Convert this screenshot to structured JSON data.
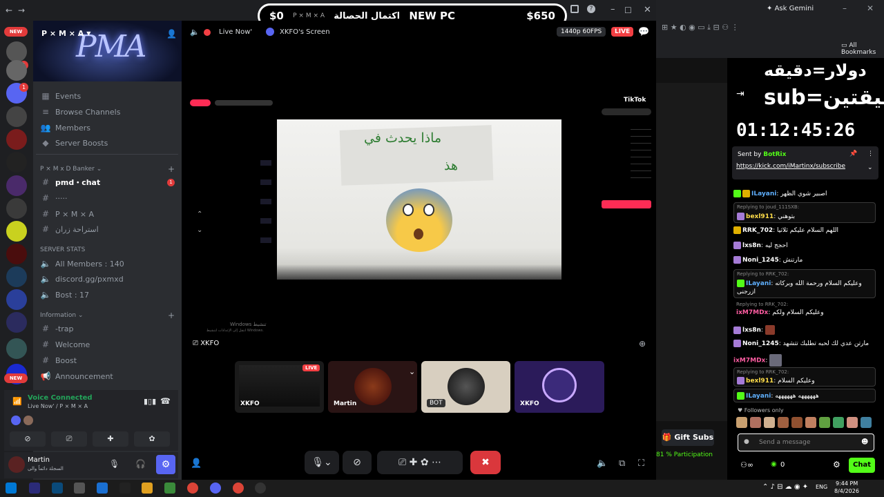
{
  "overlay": {
    "left_amount": "$0",
    "server_tag": "P × M × A",
    "goal_text": "اكتمال الحصالة",
    "goal_item": "NEW PC",
    "right_amount": "$650"
  },
  "server": {
    "name": "P × M × A"
  },
  "rail": {
    "badges": [
      "NEW",
      "1",
      "1",
      "1",
      "NEW"
    ]
  },
  "sidebar": {
    "menu": [
      "Events",
      "Browse Channels",
      "Members",
      "Server Boosts"
    ],
    "category1": "P × M x D Banker",
    "channels1": [
      {
        "icon": "#",
        "label": "pmd・chat",
        "badge": "1"
      },
      {
        "icon": "#",
        "label": "·····"
      },
      {
        "icon": "#",
        "label": "P × M × A"
      },
      {
        "icon": "#",
        "label": "استراحة زران"
      }
    ],
    "category2": "SERVER STATS",
    "stats": [
      "All Members : 140",
      "discord.gg/pxmxd",
      "Bost : 17"
    ],
    "category3": "Information",
    "channels3": [
      "-trap",
      "Welcome",
      "Boost",
      "Announcement"
    ]
  },
  "voice": {
    "status": "Voice Connected",
    "channel": "Live Now' / P × M × A"
  },
  "user": {
    "name": "Martin",
    "status": "السجلة دائماً والى"
  },
  "stream": {
    "live_label": "Live Now'",
    "screen_title": "XKFO's Screen",
    "quality": "1440p 60FPS",
    "live_badge": "LIVE"
  },
  "screen": {
    "arabic_title_1": "ماذا يحدث في",
    "arabic_title_2": "هذ",
    "tiktok": "TikTok",
    "activate_windows": "Windows تنشيط",
    "activate_sub": "انتقل إلى الإعدادات لتنشيط Windows."
  },
  "participants": {
    "label": "XKFO"
  },
  "tiles": [
    {
      "name": "XKFO",
      "live": "LIVE",
      "bg": "#1a1a1a"
    },
    {
      "name": "Martin",
      "bg": "#2a1414"
    },
    {
      "name": "BOT",
      "bg": "#d8cfc0"
    },
    {
      "name": "XKFO",
      "bg": "#2b1b5a"
    }
  ],
  "browser": {
    "tab": "Ask Gemini",
    "bookmarks": "All Bookmarks",
    "overlay_line1": "دولار=دقيقه",
    "overlay_line2": "sub=دقيقتين",
    "timer": "01:12:45:26",
    "pinned_by": "Sent by",
    "pinned_user": "BotRix",
    "pinned_link": "https://kick.com/iMartinx/subscribe",
    "followers_only": "Followers only",
    "gift_subs": "Gift Subs",
    "participation": "81 % Participation",
    "send_placeholder": "Send a message",
    "chat_btn": "Chat",
    "points": "0"
  },
  "chat": [
    {
      "type": "msg",
      "user": "ILayani",
      "color": "#5fb0ff",
      "text": "اصبير شوي الظهر"
    },
    {
      "type": "reply",
      "reply_to": "Replying to joud_111SXB:",
      "user": "bexl911",
      "color": "#ffde4a",
      "text": "بتوهني"
    },
    {
      "type": "msg",
      "user": "RRK_702",
      "color": "#ffffff",
      "text": "اللهم السلام عليكم ثلاثيا"
    },
    {
      "type": "msg",
      "user": "lxs8n",
      "color": "#ffffff",
      "text": "احجج ليه"
    },
    {
      "type": "msg",
      "user": "Noni_1245",
      "color": "#ffffff",
      "text": "مارتنش"
    },
    {
      "type": "reply",
      "reply_to": "Replying to RRK_702:",
      "user": "ILayani",
      "color": "#5fb0ff",
      "text": "وعليكم السلام ورحمة الله وبركاته ازرجنى"
    },
    {
      "type": "reply",
      "reply_to": "Replying to RRK_702:",
      "user": "ixM7MDx",
      "color": "#ff5da2",
      "text": "وعليكم السلام ولكم"
    },
    {
      "type": "msg",
      "user": "lxs8n",
      "color": "#ffffff",
      "text": ""
    },
    {
      "type": "msg",
      "user": "Noni_1245",
      "color": "#ffffff",
      "text": "مارتن عدي لك لحبه تطلبك تتشهد"
    },
    {
      "type": "msg",
      "user": "ixM7MDx",
      "color": "#ff5da2",
      "text": ""
    },
    {
      "type": "reply",
      "reply_to": "Replying to RRK_702:",
      "user": "bexl911",
      "color": "#ffde4a",
      "text": "وعليكم السلام"
    },
    {
      "type": "msg",
      "user": "ILayani",
      "color": "#5fb0ff",
      "text": "ههههههه ههههههه"
    }
  ],
  "taskbar": {
    "lang": "ENG",
    "time": "9:44 PM",
    "date": "8/4/2026"
  }
}
